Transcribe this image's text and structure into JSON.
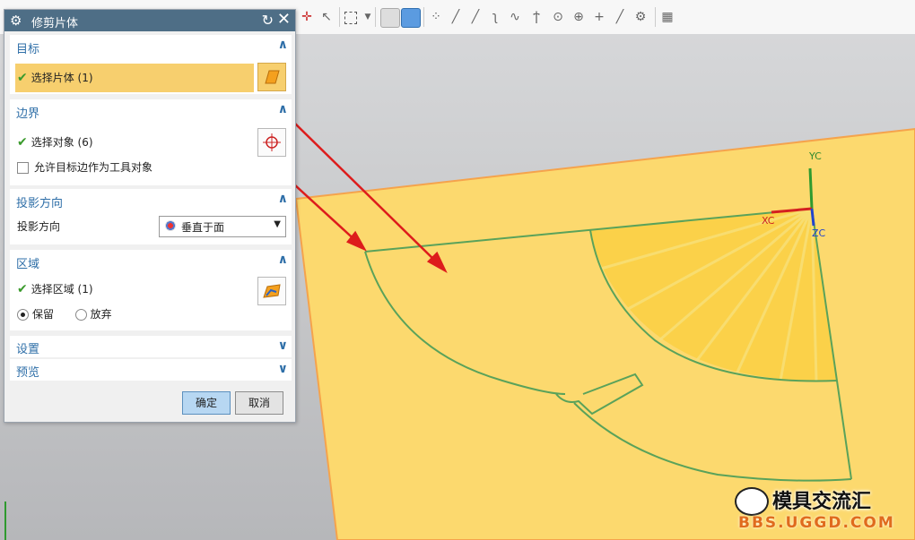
{
  "dialog": {
    "title": "修剪片体",
    "sections": {
      "target": {
        "header": "目标",
        "select_body": "选择片体 (1)"
      },
      "boundary": {
        "header": "边界",
        "select_object": "选择对象 (6)",
        "allow_target_edge": "允许目标边作为工具对象"
      },
      "projection": {
        "header": "投影方向",
        "label": "投影方向",
        "value": "垂直于面"
      },
      "region": {
        "header": "区域",
        "select_region": "选择区域 (1)",
        "keep": "保留",
        "discard": "放弃"
      },
      "settings": {
        "header": "设置"
      },
      "preview": {
        "header": "预览"
      }
    },
    "buttons": {
      "ok": "确定",
      "cancel": "取消"
    }
  },
  "axes": {
    "yc": "YC",
    "xc": "XC",
    "zc": "ZC"
  },
  "watermark": {
    "brand": "模具交流汇",
    "url": "BBS.UGGD.COM"
  },
  "icons": [
    "gear-icon",
    "reset-icon",
    "close-icon",
    "collapse-icon",
    "expand-icon",
    "checkmark-icon",
    "sheet-body-icon",
    "crosshair-icon",
    "region-icon"
  ],
  "colors": {
    "sheet": "#fcd96e",
    "sheet_edge": "#f5a34c",
    "curve": "#5aa25a",
    "arrow": "#dd1c1c",
    "highlight": "#f7cf6e",
    "title_bar": "#4e6e86"
  }
}
